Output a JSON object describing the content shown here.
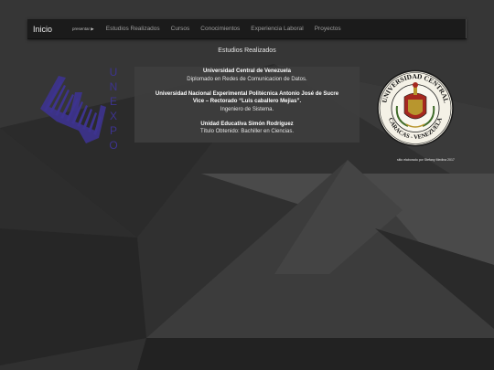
{
  "nav": {
    "brand": "Inicio",
    "present": "presentar",
    "present_arrow": "▶",
    "items": [
      "Estudios Realizados",
      "Cursos",
      "Conocimientos",
      "Experiencia Laboral",
      "Proyectos"
    ]
  },
  "page": {
    "section_title": "Estudios Realizados",
    "credit": "sitio elaborado por Stefany Medina 2017"
  },
  "studies": [
    {
      "institution": "Universidad Central de Venezuela",
      "detail": "Diplomado en Redes de Comunicacion de Datos."
    },
    {
      "institution_line1": "Universidad Nacional Experimental Politécnica Antonio José de Sucre",
      "institution_line2": "Vice – Rectorado “Luis caballero Mejias”.",
      "detail": "Ingeniero de Sistema."
    },
    {
      "institution": "Unidad Educativa Simón Rodríguez",
      "detail": "Título Obtenido: Bachiller en Ciencias."
    }
  ],
  "logos": {
    "unexpo_letters": [
      "U",
      "N",
      "E",
      "X",
      "P",
      "O"
    ],
    "seal_top_text": "UNIVERSIDAD CENTRAL",
    "seal_bottom_text": "CARACAS - VENEZUELA"
  },
  "colors": {
    "background": "#2f2f2f",
    "navbar": "#1b1b1b",
    "unexpo_purple": "#3d338f",
    "seal_gold": "#b8962e",
    "seal_red": "#a5281f"
  }
}
